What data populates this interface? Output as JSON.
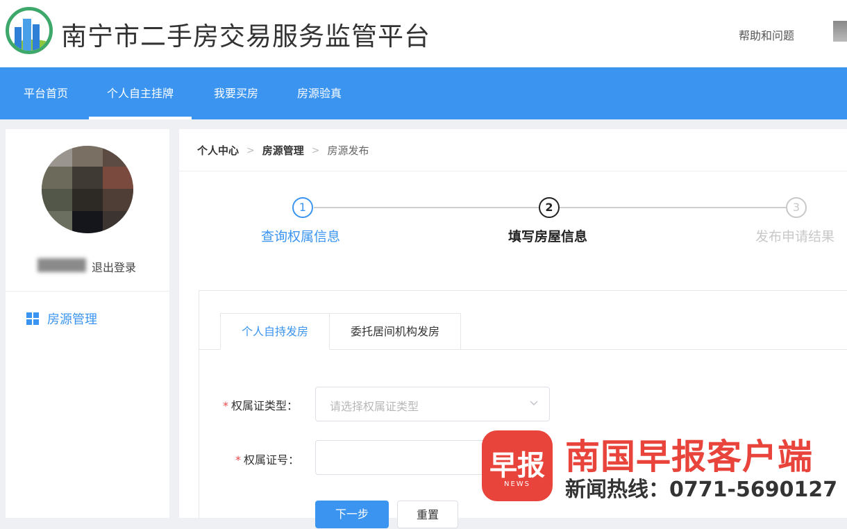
{
  "header": {
    "site_title": "南宁市二手房交易服务监管平台",
    "help_link": "帮助和问题"
  },
  "nav": {
    "items": [
      {
        "label": "平台首页"
      },
      {
        "label": "个人自主挂牌",
        "active": true
      },
      {
        "label": "我要买房"
      },
      {
        "label": "房源验真"
      }
    ]
  },
  "sidebar": {
    "logout": "退出登录",
    "menu": [
      {
        "label": "房源管理",
        "icon": "grid-icon"
      }
    ]
  },
  "breadcrumb": [
    "个人中心",
    "房源管理",
    "房源发布"
  ],
  "steps": [
    {
      "number": "1",
      "label": "查询权属信息",
      "state": "done"
    },
    {
      "number": "2",
      "label": "填写房屋信息",
      "state": "current"
    },
    {
      "number": "3",
      "label": "发布申请结果",
      "state": "todo"
    }
  ],
  "tabs": [
    {
      "label": "个人自持发房",
      "active": true
    },
    {
      "label": "委托居间机构发房",
      "active": false
    }
  ],
  "form": {
    "cert_type_label": "权属证类型：",
    "cert_type_placeholder": "请选择权属证类型",
    "cert_no_label": "权属证号：",
    "cert_no_value": "",
    "required_mark": "*",
    "next_button": "下一步",
    "reset_button": "重置"
  },
  "watermark": {
    "logo_text": "早报",
    "logo_sub": "NEWS",
    "title": "南国早报客户端",
    "hotline": "新闻热线：0771-5690127"
  },
  "colors": {
    "primary": "#3b95f0",
    "required": "#e84a4a",
    "watermark_red": "#e8443c"
  }
}
